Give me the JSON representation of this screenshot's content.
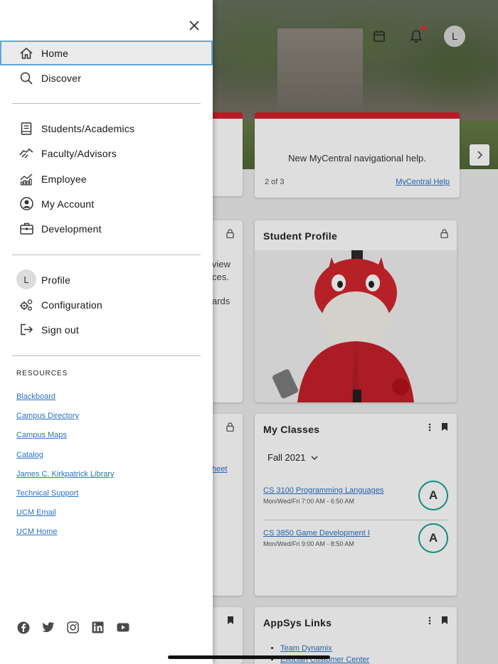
{
  "header": {
    "avatar_initial": "L"
  },
  "colors": {
    "accent_red": "#d31f2c",
    "link_blue": "#2a72c6",
    "grade_teal": "#1aa192",
    "active_border": "#5ea6e2"
  },
  "announcement": {
    "text": "New MyCentral navigational help.",
    "pager": "2 of 3",
    "link": "MyCentral Help"
  },
  "left_fragments": {
    "frag1": "view",
    "frag2": "ces.",
    "frag3": "ards",
    "frag4": "heet"
  },
  "student_profile": {
    "title": "Student Profile"
  },
  "my_classes": {
    "title": "My Classes",
    "term": "Fall 2021",
    "classes": [
      {
        "name": "CS 3100 Programming Languages",
        "schedule": "Mon/Wed/Fri 7:00 AM - 6:50 AM",
        "grade": "A"
      },
      {
        "name": "CS 3850 Game Development I",
        "schedule": "Mon/Wed/Fri 9:00 AM - 8:50 AM",
        "grade": "A"
      }
    ]
  },
  "appsys": {
    "title": "AppSys Links",
    "links": [
      "Team Dynamix",
      "Ellucian Customer Center"
    ]
  },
  "drawer": {
    "primary": [
      {
        "label": "Home",
        "icon": "home-icon"
      },
      {
        "label": "Discover",
        "icon": "search-icon"
      }
    ],
    "sections": [
      {
        "label": "Students/Academics",
        "icon": "book-icon"
      },
      {
        "label": "Faculty/Advisors",
        "icon": "handshake-icon"
      },
      {
        "label": "Employee",
        "icon": "chart-icon"
      },
      {
        "label": "My Account",
        "icon": "account-circle-icon"
      },
      {
        "label": "Development",
        "icon": "briefcase-icon"
      }
    ],
    "account": [
      {
        "label": "Profile",
        "icon": "avatar"
      },
      {
        "label": "Configuration",
        "icon": "gears-icon"
      },
      {
        "label": "Sign out",
        "icon": "sign-out-icon"
      }
    ],
    "resources_title": "RESOURCES",
    "resources": [
      "Blackboard",
      "Campus Directory",
      "Campus Maps",
      "Catalog",
      "James C. Kirkpatrick Library",
      "Technical Support",
      "UCM Email",
      "UCM Home"
    ],
    "social": [
      "facebook-icon",
      "twitter-icon",
      "instagram-icon",
      "linkedin-icon",
      "youtube-icon"
    ]
  }
}
